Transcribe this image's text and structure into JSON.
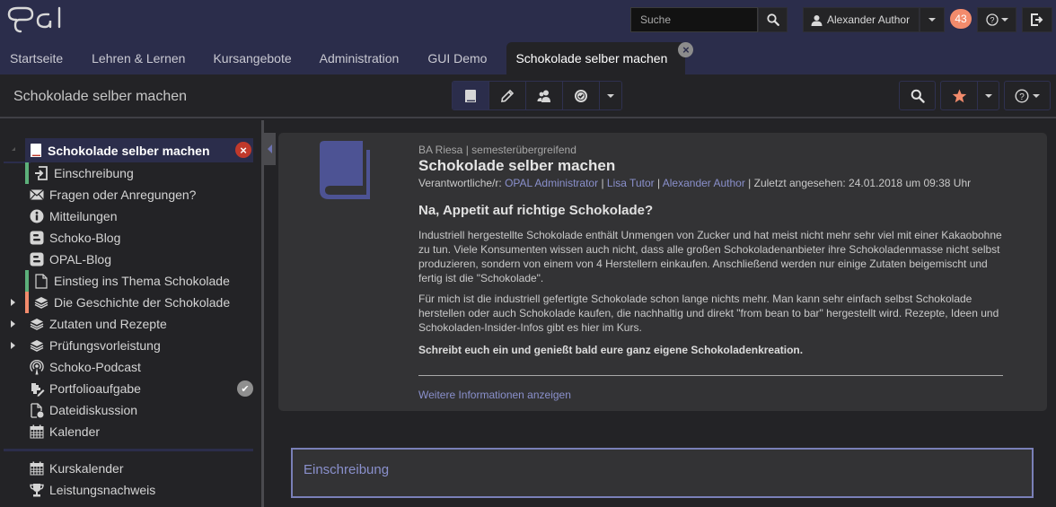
{
  "header": {
    "logo_text": "OPAL",
    "search": {
      "placeholder": "Suche",
      "value": ""
    },
    "user_name": "Alexander Author",
    "notification_count": "43",
    "help_label": "help",
    "logout_label": "logout"
  },
  "main_tabs": [
    {
      "label": "Startseite",
      "active": false
    },
    {
      "label": "Lehren & Lernen",
      "active": false
    },
    {
      "label": "Kursangebote",
      "active": false
    },
    {
      "label": "Administration",
      "active": false
    },
    {
      "label": "GUI Demo",
      "active": false
    },
    {
      "label": "Schokolade selber machen",
      "active": true,
      "closable": true
    }
  ],
  "course_bar": {
    "title": "Schokolade selber machen",
    "tools": [
      {
        "icon": "book-icon",
        "active": true
      },
      {
        "icon": "pencil-icon",
        "active": false
      },
      {
        "icon": "users-icon",
        "active": false
      },
      {
        "icon": "badge-check-icon",
        "active": false
      },
      {
        "icon": "chevron-down-icon",
        "active": false
      }
    ],
    "right_tools": [
      "search-icon",
      "star-icon",
      "help-icon"
    ]
  },
  "sidebar": {
    "root": {
      "label": "Schokolade selber machen",
      "icon": "book-icon"
    },
    "items": [
      {
        "label": "Einschreibung",
        "icon": "enroll-icon",
        "indent": true,
        "status_color": "#5cb07a"
      },
      {
        "label": "Fragen oder Anregungen?",
        "icon": "envelope-icon"
      },
      {
        "label": "Mitteilungen",
        "icon": "info-icon"
      },
      {
        "label": "Schoko-Blog",
        "icon": "blog-icon"
      },
      {
        "label": "OPAL-Blog",
        "icon": "blog-icon"
      },
      {
        "label": "Einstieg ins Thema Schokolade",
        "icon": "page-icon",
        "indent": true,
        "status_color": "#5cb07a"
      },
      {
        "label": "Die Geschichte der Schokolade",
        "icon": "layers-icon",
        "indent": true,
        "expandable": true,
        "status_color": "#f28b6c"
      },
      {
        "label": "Zutaten und Rezepte",
        "icon": "layers-icon",
        "expandable": true
      },
      {
        "label": "Prüfungsvorleistung",
        "icon": "layers-icon",
        "expandable": true
      },
      {
        "label": "Schoko-Podcast",
        "icon": "podcast-icon"
      },
      {
        "label": "Portfolioaufgabe",
        "icon": "portfolio-icon",
        "done": true
      },
      {
        "label": "Dateidiskussion",
        "icon": "file-discussion-icon"
      },
      {
        "label": "Kalender",
        "icon": "calendar-icon"
      }
    ],
    "footer_items": [
      {
        "label": "Kurskalender",
        "icon": "calendar-icon"
      },
      {
        "label": "Leistungsnachweis",
        "icon": "trophy-icon"
      }
    ]
  },
  "course_info": {
    "meta": "BA Riesa | semesterübergreifend",
    "title": "Schokolade selber machen",
    "responsible_label": "Verantwortliche/r:",
    "responsible": [
      "OPAL Administrator",
      "Lisa Tutor",
      "Alexander Author"
    ],
    "last_viewed": "Zuletzt angesehen: 24.01.2018 um 09:38 Uhr",
    "heading": "Na, Appetit auf richtige Schokolade?",
    "paragraph1": "Industriell hergestellte Schokolade enthält Unmengen von Zucker und hat meist nicht mehr sehr viel mit einer Kakaobohne zu tun. Viele Konsumenten wissen auch nicht, dass alle großen Schokoladenanbieter ihre Schokoladenmasse nicht selbst produzieren, sondern von einem von 4 Herstellern einkaufen. Anschließend werden nur einige Zutaten beigemischt und fertig ist die \"Schokolade\".",
    "paragraph2": "Für mich ist die industriell gefertigte Schokolade schon lange nichts mehr. Man kann sehr einfach selbst Schokolade herstellen oder auch Schokolade kaufen, die nachhaltig und direkt \"from bean to bar\" hergestellt wird. Rezepte, Ideen und Schokoladen-Insider-Infos gibt es hier im Kurs.",
    "paragraph3": "Schreibt euch ein und genießt bald eure ganz eigene Schokoladenkreation.",
    "more_link": "Weitere Informationen anzeigen"
  },
  "enrollment": {
    "title": "Einschreibung"
  },
  "colors": {
    "header_bg": "#2b2d4b",
    "accent": "#8a90cc",
    "badge": "#f28b6c",
    "success": "#5cb07a",
    "danger": "#c0392b"
  }
}
